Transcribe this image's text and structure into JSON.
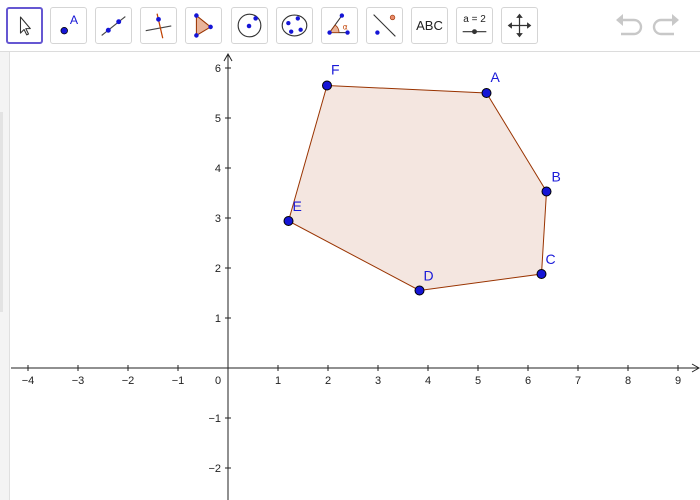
{
  "toolbar": {
    "tools": [
      {
        "name": "move-tool",
        "icon": "arrow-cursor-icon",
        "selected": true
      },
      {
        "name": "point-tool",
        "icon": "point-icon",
        "label": "A"
      },
      {
        "name": "line-tool",
        "icon": "line-through-points-icon"
      },
      {
        "name": "perpendicular-line-tool",
        "icon": "perpendicular-line-icon"
      },
      {
        "name": "polygon-tool",
        "icon": "polygon-icon"
      },
      {
        "name": "circle-tool",
        "icon": "circle-center-point-icon"
      },
      {
        "name": "conic-tool",
        "icon": "conic-five-points-icon"
      },
      {
        "name": "angle-tool",
        "icon": "angle-icon",
        "label": "α"
      },
      {
        "name": "reflect-tool",
        "icon": "reflect-about-line-icon"
      },
      {
        "name": "text-tool",
        "icon": "text-icon",
        "label": "ABC"
      },
      {
        "name": "slider-tool",
        "icon": "slider-icon",
        "label": "a = 2"
      },
      {
        "name": "move-graphics-view-tool",
        "icon": "move-arrows-icon"
      }
    ],
    "undo_icon": "undo-icon",
    "redo_icon": "redo-icon"
  },
  "graphics": {
    "x_ticks": [
      "−4",
      "−3",
      "−2",
      "−1",
      "0",
      "1",
      "2",
      "3",
      "4",
      "5",
      "6",
      "7",
      "8",
      "9"
    ],
    "y_ticks_positive": [
      "1",
      "2",
      "3",
      "4",
      "5",
      "6"
    ],
    "y_ticks_negative": [
      "−1",
      "−2"
    ],
    "polygon": {
      "fill_color": "#f4e6e0",
      "edge_color": "#993300",
      "point_color": "#1515d6",
      "label_color": "#1a1ad8",
      "vertices": [
        {
          "label": "A",
          "x": 5.17,
          "y": 5.5
        },
        {
          "label": "B",
          "x": 6.37,
          "y": 3.53
        },
        {
          "label": "C",
          "x": 6.27,
          "y": 1.88
        },
        {
          "label": "D",
          "x": 3.83,
          "y": 1.55
        },
        {
          "label": "E",
          "x": 1.21,
          "y": 2.94
        },
        {
          "label": "F",
          "x": 1.98,
          "y": 5.65
        }
      ]
    }
  }
}
